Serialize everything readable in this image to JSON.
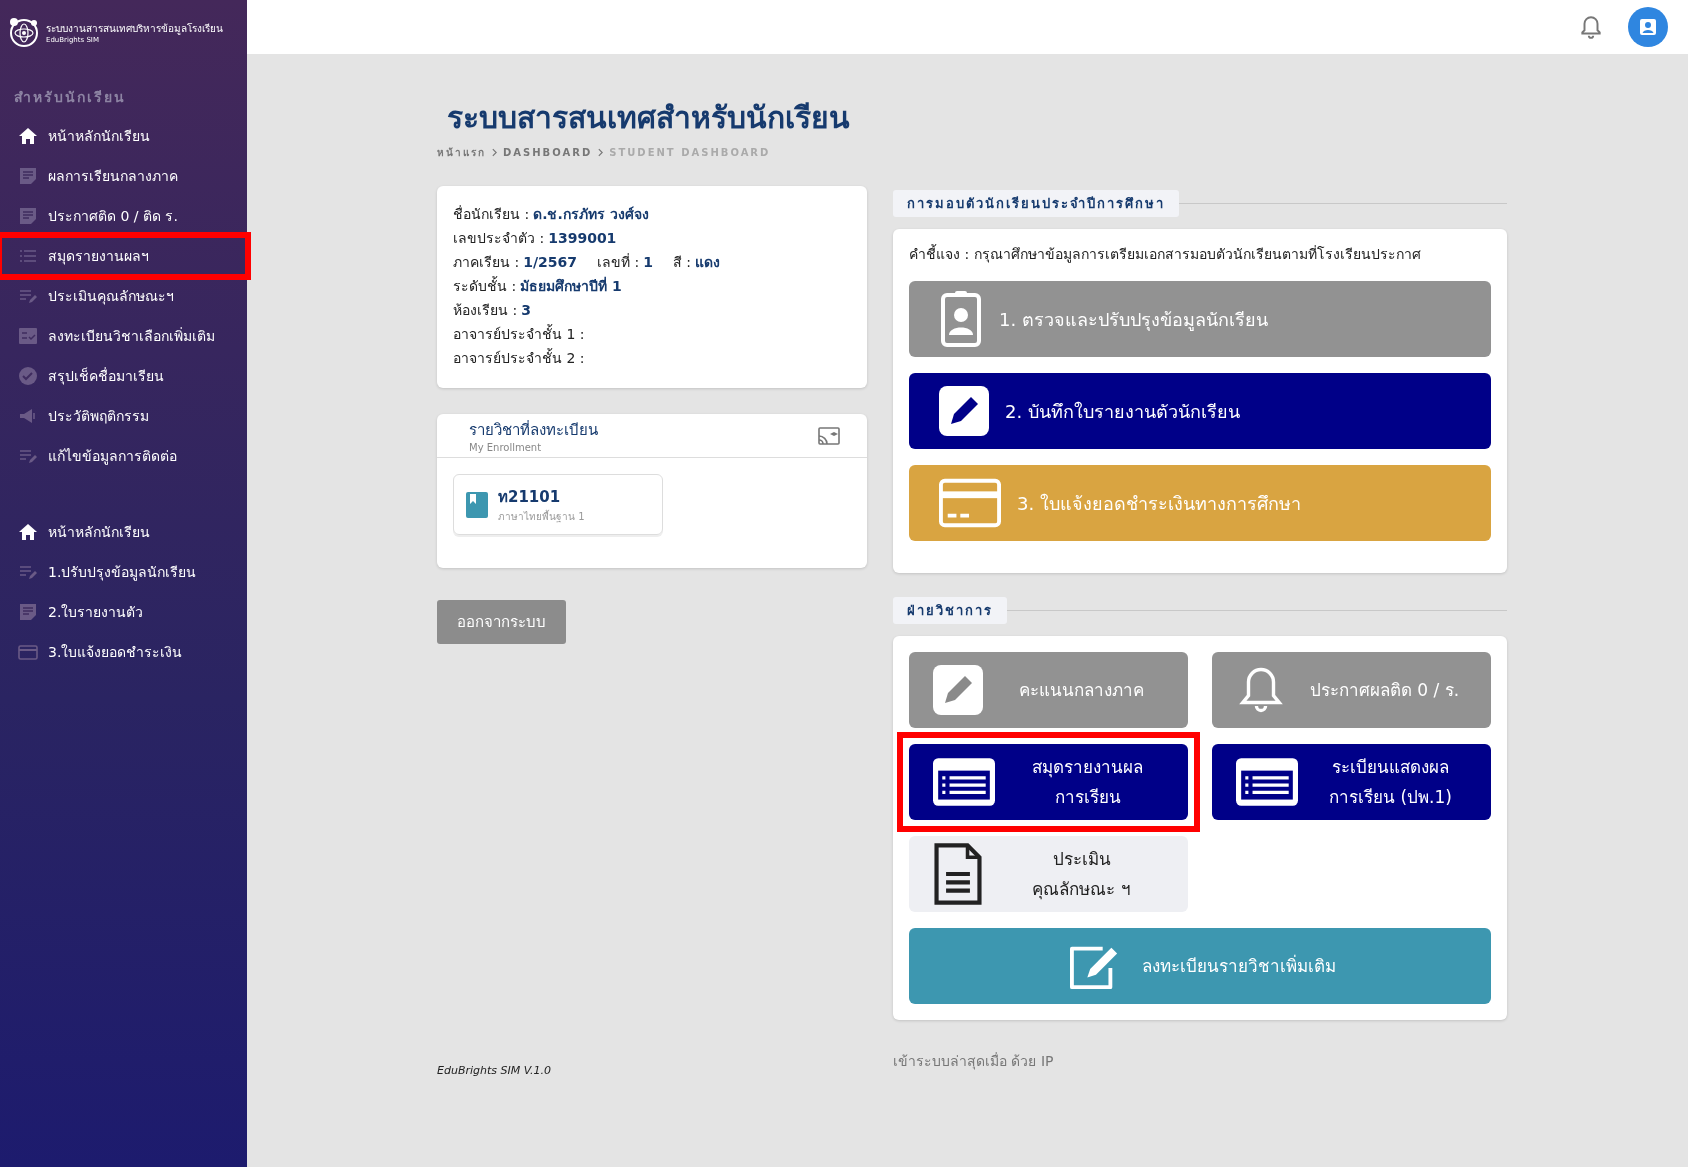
{
  "brand": {
    "title": "ระบบงานสารสนเทศบริหารข้อมูลโรงเรียน",
    "subtitle": "EduBrights SIM"
  },
  "sidebar": {
    "heading": "สำหรับนักเรียน",
    "groups": [
      [
        {
          "label": "หน้าหลักนักเรียน",
          "kind": "home",
          "highlighted": false
        },
        {
          "label": "ผลการเรียนกลางภาค",
          "kind": "note",
          "highlighted": false
        },
        {
          "label": "ประกาศติด 0 / ติด ร.",
          "kind": "note",
          "highlighted": false
        },
        {
          "label": "สมุดรายงานผลฯ",
          "kind": "list",
          "highlighted": true
        },
        {
          "label": "ประเมินคุณลักษณะฯ",
          "kind": "edit",
          "highlighted": false
        },
        {
          "label": "ลงทะเบียนวิชาเลือกเพิ่มเติม",
          "kind": "checklist",
          "highlighted": false
        },
        {
          "label": "สรุปเช็คชื่อมาเรียน",
          "kind": "check",
          "highlighted": false
        },
        {
          "label": "ประวัติพฤติกรรม",
          "kind": "megaphone",
          "highlighted": false
        },
        {
          "label": "แก้ไขข้อมูลการติดต่อ",
          "kind": "edit",
          "highlighted": false
        }
      ],
      [
        {
          "label": "หน้าหลักนักเรียน",
          "kind": "home",
          "highlighted": false
        },
        {
          "label": "1.ปรับปรุงข้อมูลนักเรียน",
          "kind": "edit",
          "highlighted": false
        },
        {
          "label": "2.ใบรายงานตัว",
          "kind": "note",
          "highlighted": false
        },
        {
          "label": "3.ใบแจ้งยอดชำระเงิน",
          "kind": "card",
          "highlighted": false
        }
      ]
    ]
  },
  "page": {
    "title": "ระบบสารสนเทศสำหรับนักเรียน",
    "breadcrumb": [
      "หน้าแรก",
      "DASHBOARD",
      "STUDENT DASHBOARD"
    ]
  },
  "student": [
    [
      {
        "label": "ชื่อนักเรียน :",
        "value": "ด.ช.กรภัทร วงศ์จง"
      }
    ],
    [
      {
        "label": "เลขประจำตัว :",
        "value": "1399001"
      }
    ],
    [
      {
        "label": "ภาคเรียน :",
        "value": "1/2567"
      },
      {
        "label": "เลขที่ :",
        "value": "1"
      },
      {
        "label": "สี :",
        "value": "แดง"
      }
    ],
    [
      {
        "label": "ระดับชั้น :",
        "value": "มัธยมศึกษาปีที่ 1"
      }
    ],
    [
      {
        "label": "ห้องเรียน :",
        "value": "3"
      }
    ],
    [
      {
        "label": "อาจารย์ประจำชั้น 1 :"
      }
    ],
    [
      {
        "label": "อาจารย์ประจำชั้น 2 :"
      }
    ]
  ],
  "enrollment": {
    "title": "รายวิชาที่ลงทะเบียน",
    "subtitle": "My Enrollment",
    "courses": [
      {
        "code": "ท21101",
        "name": "ภาษาไทยพื้นฐาน 1"
      }
    ]
  },
  "logout": "ออกจากระบบ",
  "version": "EduBrights SIM V.1.0",
  "report_section": {
    "title": "การมอบตัวนักเรียนประจำปีการศึกษา",
    "note": "คำชี้แจง : กรุณาศึกษาข้อมูลการเตรียมเอกสารมอบตัวนักเรียนตามที่โรงเรียนประกาศ",
    "buttons": [
      {
        "label": "1. ตรวจและปรับปรุงข้อมูลนักเรียน",
        "kind": "badge",
        "color": "#929292"
      },
      {
        "label": "2. บันทึกใบรายงานตัวนักเรียน",
        "kind": "pencil",
        "color": "#000088"
      },
      {
        "label": "3. ใบแจ้งยอดชำระเงินทางการศึกษา",
        "kind": "card",
        "color": "#d9a441"
      }
    ]
  },
  "academic_section": {
    "title": "ฝ่ายวิชาการ",
    "buttons": [
      {
        "label": "คะแนนกลางภาค",
        "kind": "pencil",
        "color": "#929292",
        "dark_text": false,
        "highlighted": false,
        "wide": false
      },
      {
        "label": "ประกาศผลติด 0 / ร.",
        "kind": "bell",
        "color": "#929292",
        "dark_text": false,
        "highlighted": false,
        "wide": false
      },
      {
        "label": "สมุดรายงานผล\nการเรียน",
        "kind": "list",
        "color": "#000088",
        "dark_text": false,
        "highlighted": true,
        "wide": false
      },
      {
        "label": "ระเบียนแสดงผล\nการเรียน (ปพ.1)",
        "kind": "list",
        "color": "#000088",
        "dark_text": false,
        "highlighted": false,
        "wide": false
      },
      {
        "label": "ประเมิน\nคุณลักษณะ ฯ",
        "kind": "document",
        "color": "#eeeff3",
        "dark_text": true,
        "highlighted": false,
        "wide": false
      },
      {
        "label": "ลงทะเบียนรายวิชาเพิ่มเติม",
        "kind": "edit",
        "color": "#3d97b0",
        "dark_text": false,
        "highlighted": false,
        "wide": true
      }
    ]
  },
  "last_login": "เข้าระบบล่าสุดเมื่อ ด้วย IP"
}
